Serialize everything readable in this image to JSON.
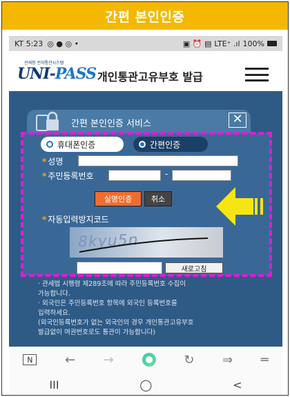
{
  "banner": {
    "title": "간편 본인인증"
  },
  "statusbar": {
    "time": "KT 5:23",
    "notif_icons": "◎ ● ◎ •",
    "right_icons": "▣ ⏰ ▤",
    "signal": "LTE⁺ .ıl",
    "battery": "100%"
  },
  "header": {
    "logo_small": "관세청 전자통관시스템",
    "logo_uni": "UNI-",
    "logo_pass": "PASS",
    "title": "개인통관고유부호 발급"
  },
  "modal": {
    "title": "간편 본인인증 서비스",
    "close": "✕",
    "tab_phone": "휴대폰인증",
    "tab_simple": "간편인증",
    "name_label": "성명",
    "rrn_label": "주민등록번호",
    "rrn_sep": "-",
    "verify_button": "실명인증",
    "cancel_button": "취소",
    "captcha_label": "자동입력방지코드",
    "captcha_text": "8kyu5n",
    "refresh_button": "새로고침",
    "notes": [
      "· 관세법 시행령 제289조에 따라 주민등록번호 수집이",
      "  가능합니다.",
      "· 외국인은 주민등록번호 항목에 외국인 등록번호를",
      "  입력하세요.",
      "  (외국인등록번호가 없는 외국인의 경우 개인통관고유부호",
      "  발급없이 여권번호로도 통관이 가능합니다)"
    ]
  },
  "browser": {
    "tabs": "N",
    "back": "←",
    "forward": "→",
    "reload": "↻",
    "share": "⇒",
    "menu": "═"
  },
  "nav": {
    "recent": "III",
    "home": "◯",
    "back": "<"
  },
  "colors": {
    "banner": "#f5b800",
    "page_bg": "#2e5a86",
    "dash": "#e619d9",
    "arrow": "#f7e511",
    "verify": "#ef6d2e"
  }
}
